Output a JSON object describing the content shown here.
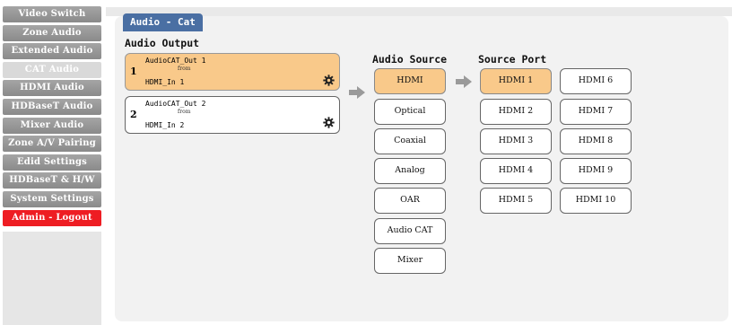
{
  "sidebar": {
    "items": [
      {
        "label": "Video Switch"
      },
      {
        "label": "Zone Audio"
      },
      {
        "label": "Extended Audio"
      },
      {
        "label": "CAT Audio"
      },
      {
        "label": "HDMI Audio"
      },
      {
        "label": "HDBaseT Audio"
      },
      {
        "label": "Mixer Audio"
      },
      {
        "label": "Zone A/V Pairing"
      },
      {
        "label": "Edid Settings"
      },
      {
        "label": "HDBaseT & H/W"
      },
      {
        "label": "System Settings"
      },
      {
        "label": "Admin - Logout"
      }
    ],
    "active_index": 3
  },
  "tab": {
    "label": "Audio - Cat"
  },
  "audio_output": {
    "title": "Audio Output",
    "outputs": [
      {
        "number": "1",
        "name": "AudioCAT_Out 1",
        "from": "from",
        "source": "HDMI_In 1",
        "selected": true
      },
      {
        "number": "2",
        "name": "AudioCAT_Out 2",
        "from": "from",
        "source": "HDMI_In 2",
        "selected": false
      }
    ]
  },
  "audio_source": {
    "title": "Audio Source",
    "options": [
      "HDMI",
      "Optical",
      "Coaxial",
      "Analog",
      "OAR",
      "Audio CAT",
      "Mixer"
    ],
    "selected": "HDMI"
  },
  "source_port": {
    "title": "Source Port",
    "col1": [
      "HDMI 1",
      "HDMI 2",
      "HDMI 3",
      "HDMI 4",
      "HDMI 5"
    ],
    "col2": [
      "HDMI 6",
      "HDMI 7",
      "HDMI 8",
      "HDMI 9",
      "HDMI 10"
    ],
    "selected": "HDMI 1"
  },
  "colors": {
    "selected": "#f9c98a",
    "tab": "#4a6fa3",
    "logout": "#ee1d23",
    "sidebar": "#8a8a8a"
  }
}
